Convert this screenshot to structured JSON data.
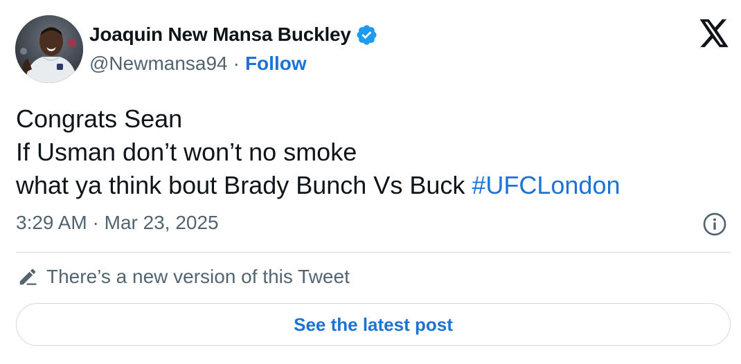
{
  "author": {
    "display_name": "Joaquin New Mansa Buckley",
    "handle": "@Newmansa94",
    "separator": "·",
    "follow_label": "Follow",
    "verified_icon": "verified-badge-icon"
  },
  "tweet": {
    "line1": "Congrats Sean",
    "line2": "If Usman don’t won’t no smoke",
    "line3_text": "what ya think bout Brady Bunch Vs Buck ",
    "hashtag": "#UFCLondon",
    "timestamp": "3:29 AM · Mar 23, 2025"
  },
  "notice": {
    "text": "There’s a new version of this Tweet",
    "icon": "pencil-icon"
  },
  "actions": {
    "see_latest_label": "See the latest post"
  },
  "icons": {
    "brand": "x-logo-icon",
    "info": "info-icon"
  },
  "colors": {
    "link": "#1d72d6",
    "verified": "#1d9bf0",
    "muted": "#536471",
    "text": "#0f1419",
    "border": "#cfd9de"
  }
}
